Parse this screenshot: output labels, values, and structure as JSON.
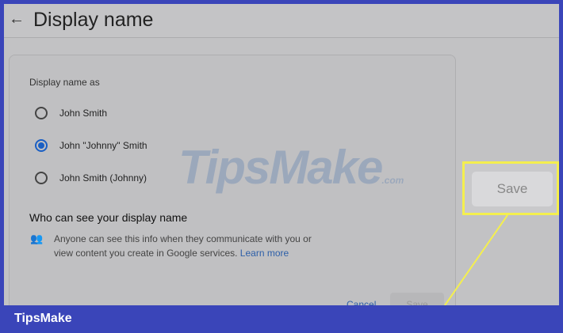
{
  "header": {
    "title": "Display name"
  },
  "form": {
    "label": "Display name as",
    "options": [
      {
        "label": "John Smith",
        "selected": false
      },
      {
        "label": "John \"Johnny\" Smith",
        "selected": true
      },
      {
        "label": "John Smith (Johnny)",
        "selected": false
      }
    ],
    "visibility_heading": "Who can see your display name",
    "visibility_text": "Anyone can see this info when they communicate with you or view content you create in Google services.",
    "learn_more": "Learn more",
    "cancel": "Cancel",
    "save": "Save"
  },
  "callout": {
    "save": "Save"
  },
  "watermark": {
    "text": "TipsMake",
    "suffix": ".com"
  },
  "footer": {
    "brand": "TipsMake"
  }
}
